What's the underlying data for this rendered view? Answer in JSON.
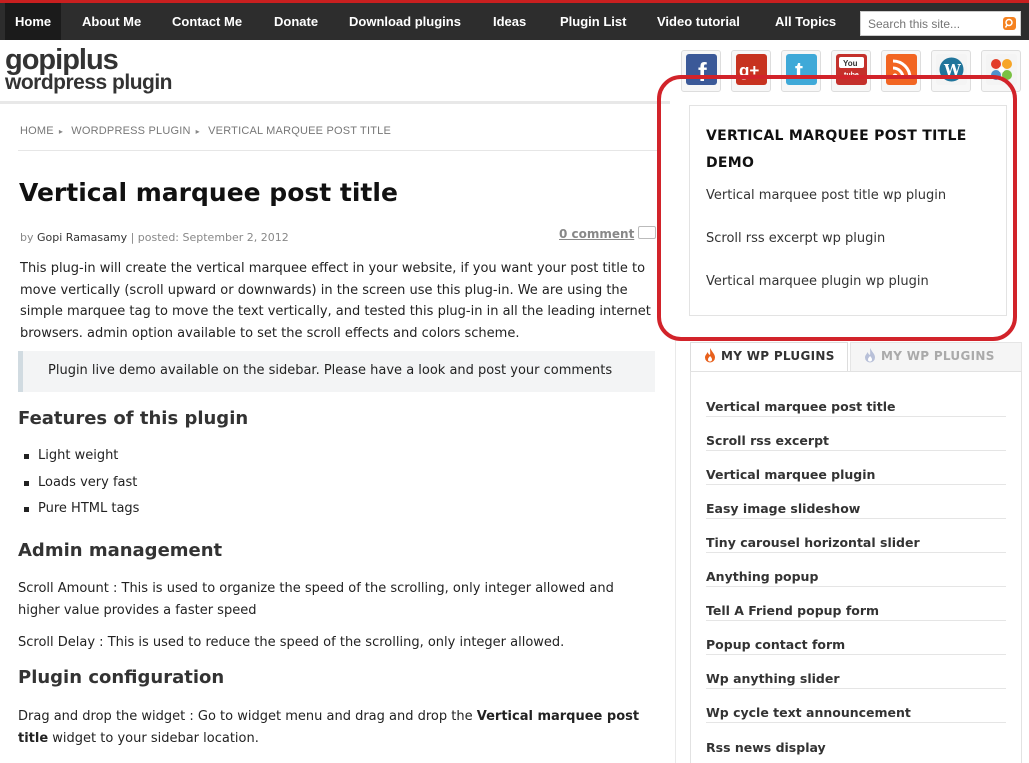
{
  "nav": {
    "items": [
      "Home",
      "About Me",
      "Contact Me",
      "Donate",
      "Download plugins",
      "Ideas",
      "Plugin List",
      "Video tutorial",
      "All Topics"
    ],
    "search_placeholder": "Search this site..."
  },
  "logo": {
    "line1": "gopiplus",
    "line2": "wordpress plugin"
  },
  "social": [
    {
      "name": "facebook-icon",
      "glyph": "f",
      "color": "#3b5998"
    },
    {
      "name": "google-plus-icon",
      "glyph": "g+",
      "color": "#c7321f"
    },
    {
      "name": "twitter-icon",
      "glyph": "t",
      "color": "#3fa9d8"
    },
    {
      "name": "youtube-icon",
      "glyph": "You\nTube",
      "color": "#c4302b"
    },
    {
      "name": "rss-icon",
      "glyph": "rss",
      "color": "#f26522"
    },
    {
      "name": "wordpress-icon",
      "glyph": "W",
      "color": "#21759b"
    },
    {
      "name": "joomla-icon",
      "glyph": "✤",
      "color": "#f2f2f2"
    }
  ],
  "breadcrumb": [
    "HOME",
    "WORDPRESS PLUGIN",
    "VERTICAL MARQUEE POST TITLE"
  ],
  "post": {
    "title": "Vertical marquee post title",
    "by": "by",
    "author": "Gopi Ramasamy",
    "posted": "| posted: September 2, 2012",
    "comments": "0 comment",
    "intro": "This plug-in will create the vertical marquee effect in your website, if you want your post title to move vertically (scroll upward or downwards) in the screen use this plug-in. We are using the simple marquee tag to move the text vertically, and tested this plug-in in all the leading internet browsers. admin option available to set the scroll effects and colors scheme.",
    "note": "Plugin live demo available on the sidebar. Please have a look and post your comments",
    "features_heading": "Features of this plugin",
    "features": [
      "Light weight",
      "Loads very fast",
      "Pure HTML tags"
    ],
    "admin_heading": "Admin management",
    "scroll_amount": "Scroll Amount : This is used to organize the speed of the scrolling, only integer allowed and higher value provides a faster speed",
    "scroll_delay": "Scroll Delay : This is used to reduce the speed of the scrolling, only integer allowed.",
    "config_heading": "Plugin configuration",
    "config_pre": "Drag and drop the widget : Go to widget menu and drag and drop the ",
    "config_bold": "Vertical marquee post title",
    "config_post": " widget to your sidebar location."
  },
  "widget": {
    "title": "VERTICAL MARQUEE POST TITLE DEMO",
    "links": [
      "Vertical marquee post title wp plugin",
      "Scroll rss excerpt wp plugin",
      "Vertical marquee plugin wp plugin"
    ]
  },
  "tabs": [
    "MY WP PLUGINS",
    "MY WP PLUGINS"
  ],
  "plugins": [
    "Vertical marquee post title",
    "Scroll rss excerpt",
    "Vertical marquee plugin",
    "Easy image slideshow",
    "Tiny carousel horizontal slider",
    "Anything popup",
    "Tell A Friend popup form",
    "Popup contact form",
    "Wp anything slider",
    "Wp cycle text announcement",
    "Rss news display"
  ],
  "colors": {
    "nav_bg": "#2d2d2d",
    "nav_accent": "#c81f1f",
    "highlight": "#d2232a",
    "search_btn": "#f58220"
  }
}
